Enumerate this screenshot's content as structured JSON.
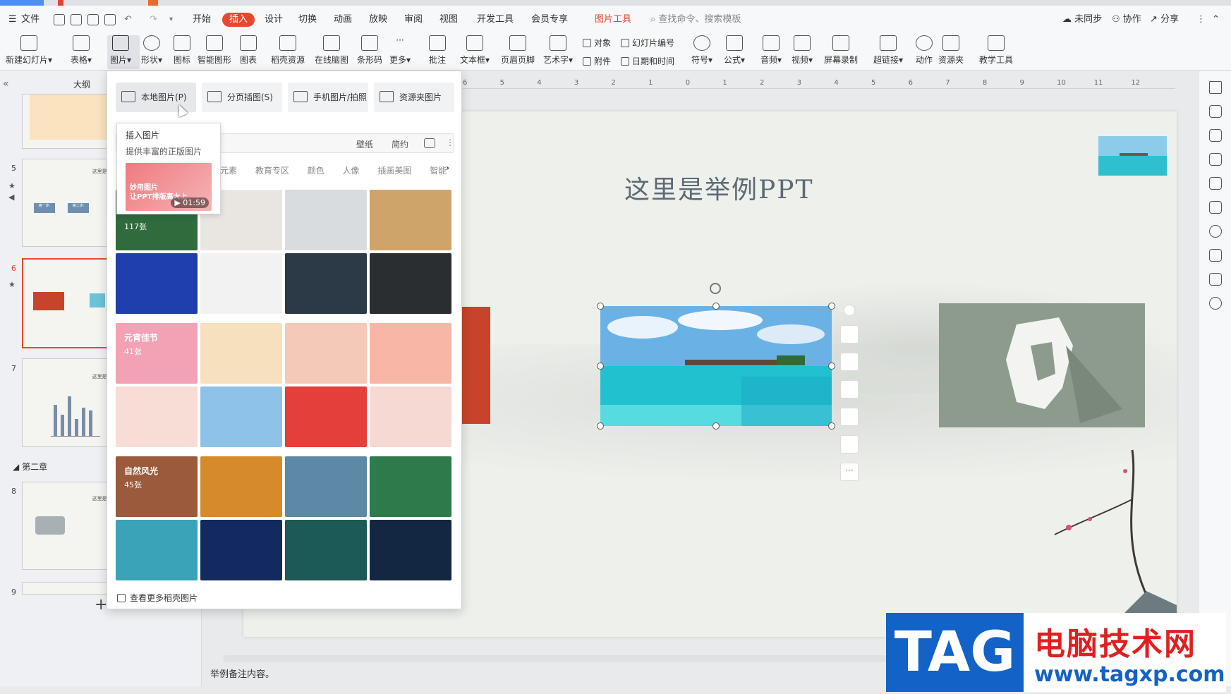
{
  "menubar": {
    "file": "文件",
    "tabs": [
      "开始",
      "插入",
      "设计",
      "切换",
      "动画",
      "放映",
      "审阅",
      "视图",
      "开发工具",
      "会员专享",
      "图片工具"
    ],
    "active_tab": "插入",
    "search_placeholder": "查找命令、搜索模板",
    "sync": "未同步",
    "collab": "协作",
    "share": "分享"
  },
  "ribbon": {
    "buttons": [
      "新建幻灯片",
      "表格",
      "图片",
      "形状",
      "图标",
      "智能图形",
      "图表",
      "稻壳资源",
      "在线脑图",
      "条形码",
      "更多",
      "批注",
      "文本框",
      "页眉页脚",
      "艺术字"
    ],
    "small_buttons": [
      "对象",
      "附件",
      "幻灯片编号",
      "日期和时间"
    ],
    "buttons2": [
      "符号",
      "公式",
      "音频",
      "视频",
      "屏幕录制",
      "超链接",
      "动作",
      "资源夹",
      "教学工具"
    ]
  },
  "left_panel": {
    "tab_outline": "大纲",
    "slide_numbers": [
      "5",
      "6",
      "7",
      "8",
      "9"
    ],
    "section": "第二章",
    "thumb5_title": "这里是举例PPT",
    "thumb5_steps": [
      "第一步:",
      "第二步:"
    ],
    "thumb7_title": "这里是举例PPT",
    "thumb8_title": "这里是举例PPT",
    "add_slide": "+"
  },
  "ruler_labels": [
    "6",
    "5",
    "4",
    "3",
    "2",
    "1",
    "0",
    "1",
    "2",
    "3",
    "4",
    "5",
    "6",
    "7",
    "8",
    "9",
    "10",
    "11",
    "12"
  ],
  "slide": {
    "title": "这里是举例PPT"
  },
  "notes": "举例备注内容。",
  "dropdown": {
    "top_buttons": [
      "本地图片(P)",
      "分页插图(S)",
      "手机图片/拍照",
      "资源夹图片"
    ],
    "chips": [
      "壁纸",
      "简约"
    ],
    "categories": [
      "元素",
      "教育专区",
      "颜色",
      "人像",
      "插画美图",
      "智能"
    ],
    "group1_count": "117张",
    "group2_label": "元宵佳节",
    "group2_count": "41张",
    "group3_label": "自然风光",
    "group3_count": "45张",
    "more": "查看更多稻壳图片"
  },
  "tooltip": {
    "title": "插入图片",
    "desc": "提供丰富的正版图片",
    "card_line1": "妙用图片",
    "card_line2": "让PPT排版高大上",
    "duration": "01:59"
  },
  "watermark": {
    "tag": "TAG",
    "cn": "电脑技术网",
    "url": "www.tagxp.com"
  },
  "colors": {
    "accent": "#e8482e",
    "ribbon_bg": "#f7f8fa",
    "slide_bg": "#eef0ec"
  }
}
